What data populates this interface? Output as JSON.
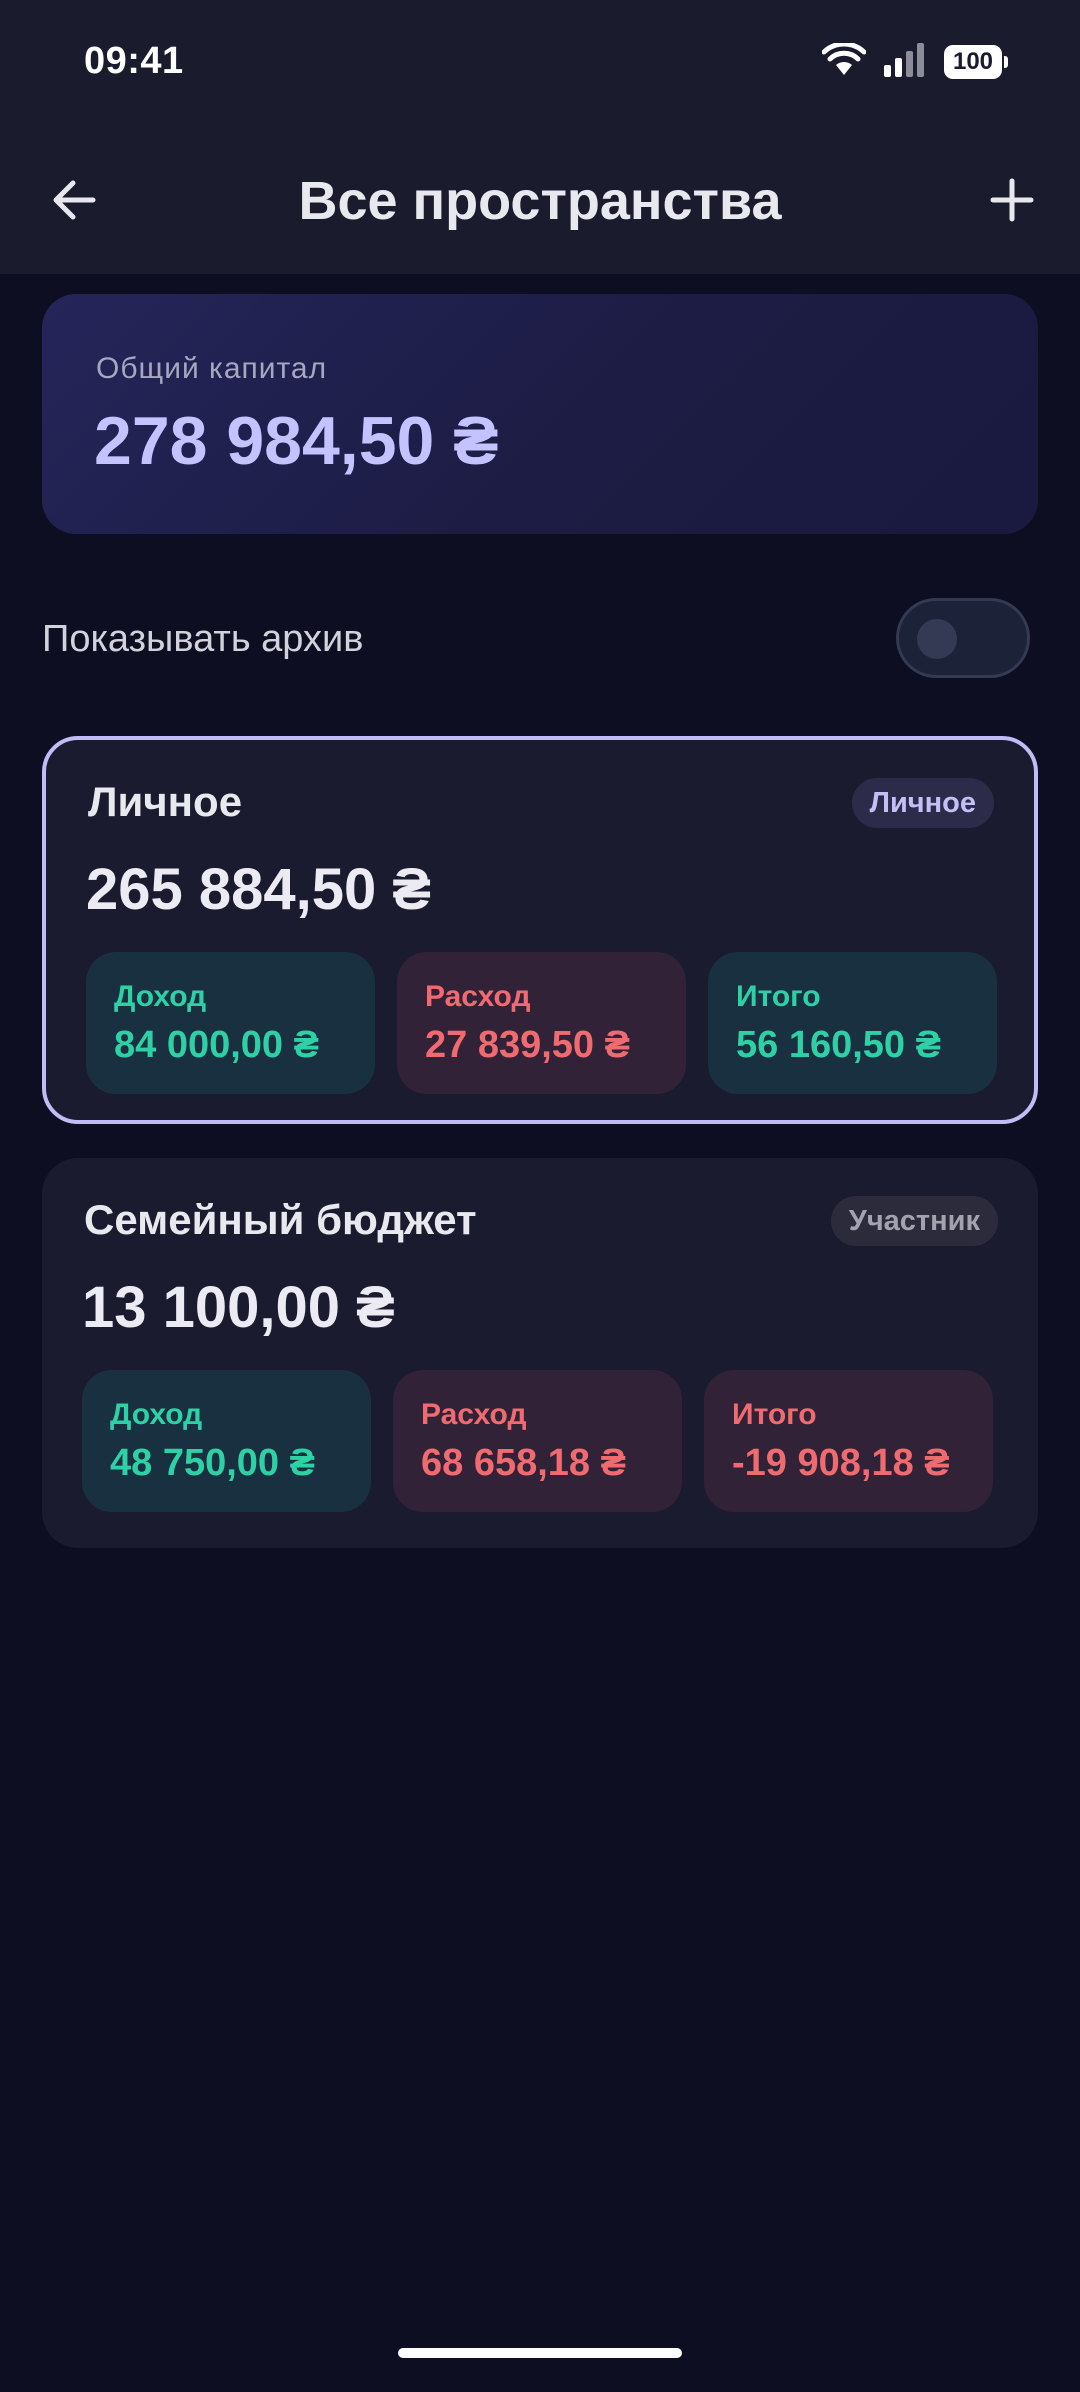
{
  "status_bar": {
    "time": "09:41",
    "battery": "100"
  },
  "header": {
    "title": "Все пространства"
  },
  "capital": {
    "label": "Общий капитал",
    "value": "278 984,50 ₴"
  },
  "archive": {
    "label": "Показывать архив",
    "enabled": false
  },
  "spaces": [
    {
      "name": "Личное",
      "badge": "Личное",
      "balance": "265 884,50 ₴",
      "selected": true,
      "income_label": "Доход",
      "income_value": "84 000,00 ₴",
      "expense_label": "Расход",
      "expense_value": "27 839,50 ₴",
      "total_label": "Итого",
      "total_value": "56 160,50 ₴"
    },
    {
      "name": "Семейный бюджет",
      "badge": "Участник",
      "balance": "13 100,00 ₴",
      "selected": false,
      "income_label": "Доход",
      "income_value": "48 750,00 ₴",
      "expense_label": "Расход",
      "expense_value": "68 658,18 ₴",
      "total_label": "Итого",
      "total_value": "-19 908,18 ₴"
    }
  ],
  "colors": {
    "income": "#2ed1a6",
    "expense": "#ef6b70",
    "accent": "#c5c3ff"
  }
}
